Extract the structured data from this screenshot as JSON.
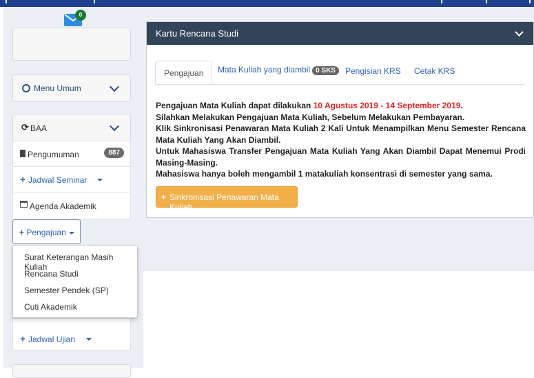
{
  "sidebar": {
    "mail_badge": "0",
    "menu_umum": "Menu Umum",
    "baa": "BAA",
    "pengumuman": "Pengumuman",
    "pengumuman_count": "887",
    "jadwal_seminar": "Jadwal Seminar",
    "agenda_akademik": "Agenda Akademik",
    "pengajuan": "Pengajuan",
    "jadwal_ujian": "Jadwal Ujian",
    "dropdown": [
      "Surat Keterangan Masih Kuliah",
      "Rencana Studi",
      "Semester Pendek (SP)",
      "Cuti Akademik"
    ]
  },
  "panel": {
    "title": "Kartu Rencana Studi",
    "tabs": {
      "pengajuan": "Pengajuan",
      "mata_kuliah": "Mata Kuliah yang diambil",
      "sks_badge": "0 SKS",
      "pengisian": "Pengisian KRS",
      "cetak": "Cetak KRS"
    },
    "line1_prefix": "Pengajuan Mata Kuliah dapat dilakukan ",
    "line1_dates": "10 Agustus 2019 - 14 September 2019",
    "line1_suffix": ".",
    "line2": "Silahkan Melakukan Pengajuan Mata Kuliah, Sebelum Melakukan Pembayaran.",
    "line3": "Klik Sinkronisasi Penawaran Mata Kuliah 2 Kali Untuk Menampilkan Menu Semester Rencana Mata Kuliah Yang Akan Diambil.",
    "line4": "Untuk Mahasiswa Transfer Pengajuan Mata Kuliah Yang Akan Diambil Dapat Menemui Prodi Masing-Masing.",
    "line5": "Mahasiswa hanya boleh mengambil 1 matakuliah konsentrasi di semester yang sama.",
    "sync_button": "Sinkronisasi Penawaran Mata Kuliah"
  }
}
